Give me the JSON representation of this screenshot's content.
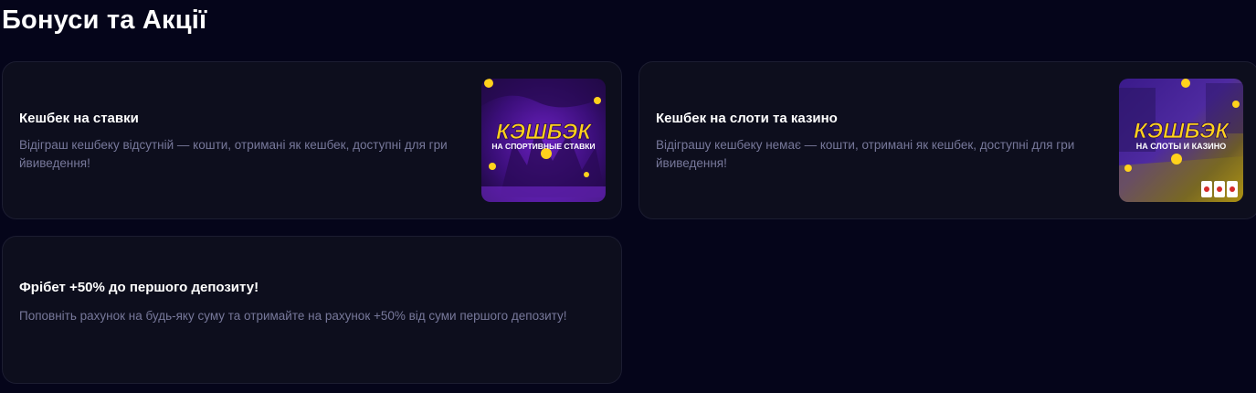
{
  "page": {
    "title": "Бонуси та Акції"
  },
  "cards": [
    {
      "title": "Кешбек на ставки",
      "description": "Відіграш кешбеку відсутній — кошти, отримані як кешбек, доступні для гри йвиведення!",
      "image": {
        "headline": "КЭШБЭК",
        "subline": "НА СПОРТИВНЫЕ СТАВКИ"
      }
    },
    {
      "title": "Кешбек на слоти та казино",
      "description": "Відіграшу кешбеку немає — кошти, отримані як кешбек, доступні для гри йвиведення!",
      "image": {
        "headline": "КЭШБЭК",
        "subline": "НА СЛОТЫ И КАЗИНО"
      }
    },
    {
      "title": "Фрібет +50% до першого депозиту!",
      "description": "Поповніть рахунок на будь-яку суму та отримайте на рахунок +50% від суми першого депозиту!"
    }
  ],
  "colors": {
    "background": "#05051a",
    "card_background": "#0d0e1d",
    "card_border": "#1c1d31",
    "title_text": "#ffffff",
    "description_text": "#77789a",
    "promo_yellow": "#ffd21c",
    "promo_purple": "#5a1aa8"
  }
}
